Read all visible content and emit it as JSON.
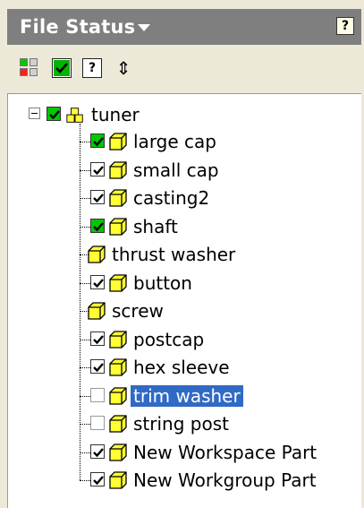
{
  "header": {
    "title": "File Status",
    "help_glyph": "?"
  },
  "toolbar": {
    "items": [
      {
        "name": "status-grid-icon"
      },
      {
        "name": "check-green-icon"
      },
      {
        "name": "help-icon",
        "glyph": "?"
      },
      {
        "name": "refresh-icon",
        "glyph": "⇕"
      }
    ]
  },
  "tree": {
    "root": {
      "label": "tuner",
      "checked": true,
      "green": true
    },
    "children": [
      {
        "label": "large cap",
        "checkbox": "green"
      },
      {
        "label": "small cap",
        "checkbox": "checked"
      },
      {
        "label": "casting2",
        "checkbox": "checked"
      },
      {
        "label": "shaft",
        "checkbox": "green"
      },
      {
        "label": "thrust washer",
        "checkbox": "none"
      },
      {
        "label": "button",
        "checkbox": "checked"
      },
      {
        "label": "screw",
        "checkbox": "none"
      },
      {
        "label": "postcap",
        "checkbox": "checked"
      },
      {
        "label": "hex sleeve",
        "checkbox": "checked"
      },
      {
        "label": "trim washer",
        "checkbox": "empty",
        "selected": true
      },
      {
        "label": "string post",
        "checkbox": "empty"
      },
      {
        "label": "New Workspace Part",
        "checkbox": "checked"
      },
      {
        "label": "New Workgroup Part",
        "checkbox": "checked"
      }
    ]
  },
  "colors": {
    "header_bg": "#7f7f7f",
    "panel_bg": "#ece9d8",
    "selection": "#316ac5",
    "green_check": "#00c800",
    "part_yellow": "#ffff33"
  }
}
